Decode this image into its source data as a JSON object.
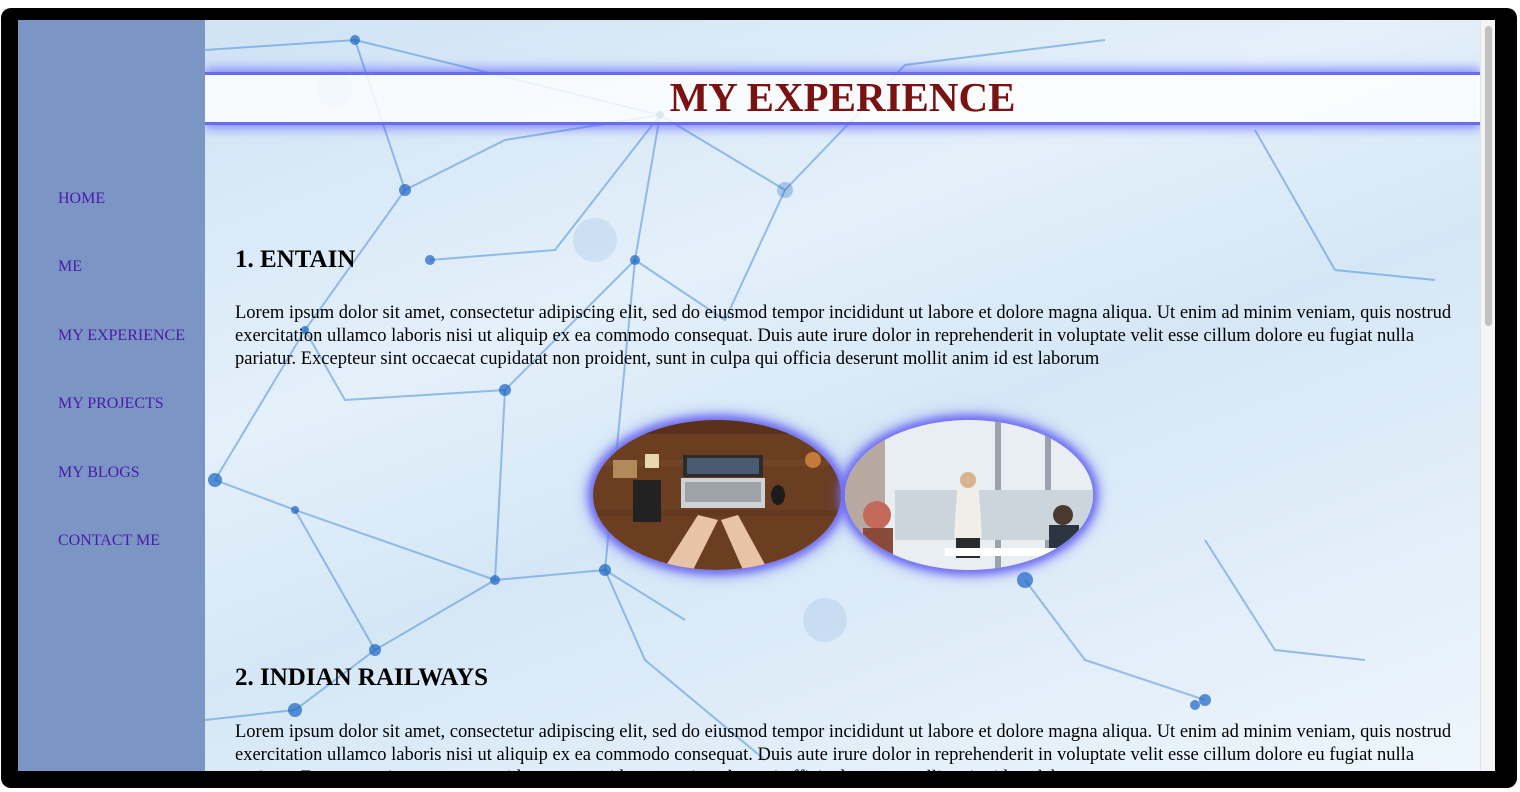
{
  "nav": {
    "items": [
      {
        "label": "HOME"
      },
      {
        "label": "ME"
      },
      {
        "label": "MY EXPERIENCE"
      },
      {
        "label": "MY PROJECTS"
      },
      {
        "label": "MY BLOGS"
      },
      {
        "label": "CONTACT ME"
      }
    ]
  },
  "header": {
    "title": "MY EXPERIENCE"
  },
  "sections": [
    {
      "heading": "1. ENTAIN",
      "body": "Lorem ipsum dolor sit amet, consectetur adipiscing elit, sed do eiusmod tempor incididunt ut labore et dolore magna aliqua. Ut enim ad minim veniam, quis nostrud exercitation ullamco laboris nisi ut aliquip ex ea commodo consequat. Duis aute irure dolor in reprehenderit in voluptate velit esse cillum dolore eu fugiat nulla pariatur. Excepteur sint occaecat cupidatat non proident, sunt in culpa qui officia deserunt mollit anim id est laborum"
    },
    {
      "heading": "2. INDIAN RAILWAYS",
      "body": "Lorem ipsum dolor sit amet, consectetur adipiscing elit, sed do eiusmod tempor incididunt ut labore et dolore magna aliqua. Ut enim ad minim veniam, quis nostrud exercitation ullamco laboris nisi ut aliquip ex ea commodo consequat. Duis aute irure dolor in reprehenderit in voluptate velit esse cillum dolore eu fugiat nulla pariatur. Excepteur sint occaecat cupidatat non proident, sunt in culpa qui officia deserunt mollit anim id est laborum"
    }
  ],
  "colors": {
    "sidebar": "#7b96c5",
    "nav_link": "#4b1aa8",
    "title": "#7a1212",
    "glow": "#6a6cf0"
  }
}
